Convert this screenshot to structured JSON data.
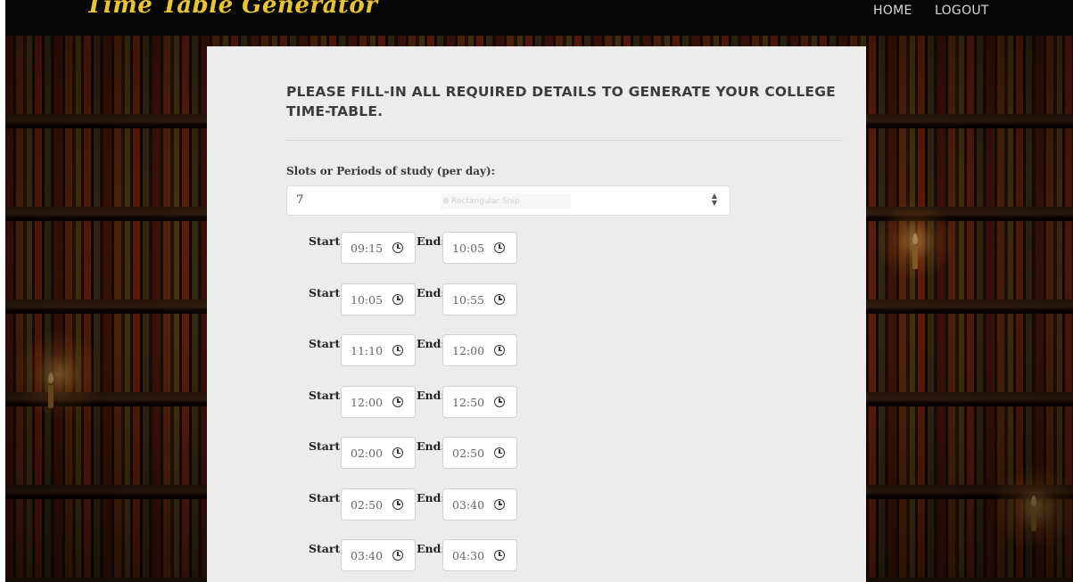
{
  "navbar": {
    "brand": "Time Table Generator",
    "links": {
      "home": "HOME",
      "logout": "LOGOUT"
    }
  },
  "form": {
    "title": "PLEASE FILL-IN ALL REQUIRED DETAILS TO GENERATE YOUR COLLEGE TIME-TABLE.",
    "slots_label": "Slots or Periods of study (per day):",
    "slots_value": "7",
    "snip_hint": "Rectangular Snip",
    "start_label": "Start:",
    "end_label": "End:",
    "periods": [
      {
        "start": "09:15",
        "end": "10:05"
      },
      {
        "start": "10:05",
        "end": "10:55"
      },
      {
        "start": "11:10",
        "end": "12:00"
      },
      {
        "start": "12:00",
        "end": "12:50"
      },
      {
        "start": "02:00",
        "end": "02:50"
      },
      {
        "start": "02:50",
        "end": "03:40"
      },
      {
        "start": "03:40",
        "end": "04:30"
      }
    ]
  },
  "colors": {
    "brand": "#e9c33a",
    "navbar_bg": "#070707",
    "panel_bg": "#ececec"
  }
}
